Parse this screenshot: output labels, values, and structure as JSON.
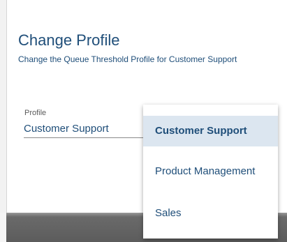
{
  "dialog": {
    "title": "Change Profile",
    "subtitle": "Change the Queue Threshold Profile for Customer Support"
  },
  "profile_field": {
    "label": "Profile",
    "value": "Customer Support"
  },
  "dropdown": {
    "options": [
      {
        "label": "Customer Support",
        "selected": true
      },
      {
        "label": "Product Management",
        "selected": false
      },
      {
        "label": "Sales",
        "selected": false
      }
    ]
  },
  "colors": {
    "text_primary": "#1f4e79",
    "selected_background": "#dce6f0",
    "footer": "#5c5c5c"
  }
}
